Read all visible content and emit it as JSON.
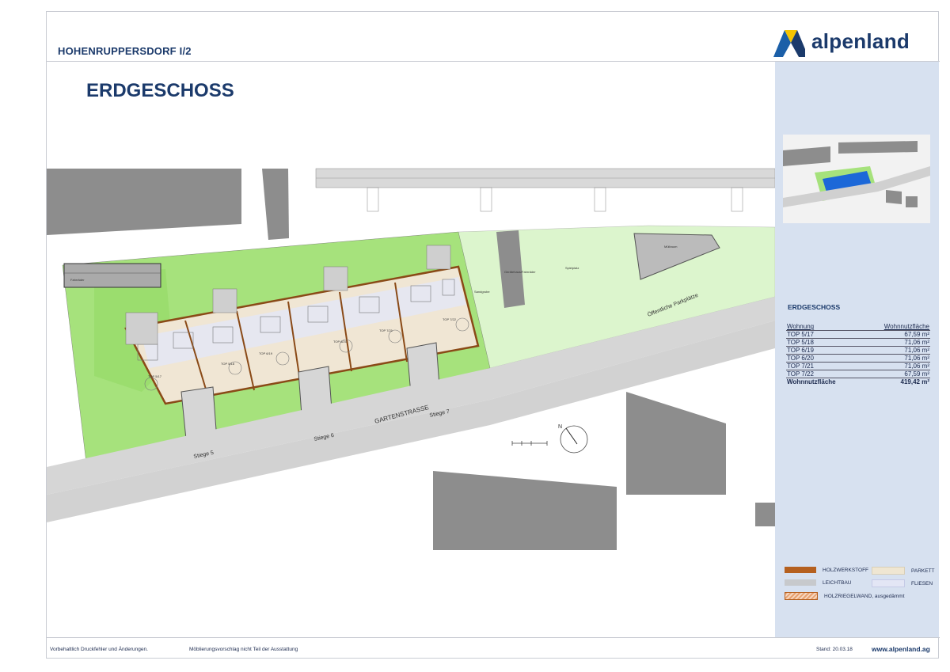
{
  "header": {
    "project": "HOHENRUPPERSDORF I/2",
    "logo_text": "alpenland"
  },
  "page_title": "ERDGESCHOSS",
  "plan": {
    "street": "GARTENSTRASSE",
    "stairs": [
      "Stiege 5",
      "Stiege 6",
      "Stiege 7"
    ],
    "parking": "Öffentliche Parkplätze",
    "labels": {
      "bike": "Fahrräder",
      "garage": "Gerätehaus/Fahrräder",
      "play": "Spielplatz",
      "sand": "Sandgrube",
      "waste": "Müllraum"
    },
    "units": [
      "TOP 5/17",
      "TOP 5/18",
      "TOP 6/19",
      "TOP 6/20",
      "TOP 7/21",
      "TOP 7/22"
    ]
  },
  "areas": {
    "title": "ERDGESCHOSS",
    "col_unit": "Wohnung",
    "col_area": "Wohnnutzfläche",
    "rows": [
      {
        "unit": "TOP 5/17",
        "area": "67,59 m²"
      },
      {
        "unit": "TOP 5/18",
        "area": "71,06 m²"
      },
      {
        "unit": "TOP 6/19",
        "area": "71,06 m²"
      },
      {
        "unit": "TOP 6/20",
        "area": "71,06 m²"
      },
      {
        "unit": "TOP 7/21",
        "area": "71,06 m²"
      },
      {
        "unit": "TOP 7/22",
        "area": "67,59 m²"
      }
    ],
    "total_label": "Wohnnutzfläche",
    "total_value": "419,42 m²"
  },
  "legend": {
    "holzwerkstoff": "HOLZWERKSTOFF",
    "parkett": "PARKETT",
    "leichtbau": "LEICHTBAU",
    "fliesen": "FLIESEN",
    "holzriegel": "HOLZRIEGELWAND, ausgedämmt",
    "colors": {
      "holzwerkstoff": "#b5601f",
      "parkett": "#efe6d2",
      "leichtbau": "#c7c9cc",
      "fliesen": "#e3e6f5",
      "holzriegel": "#e8a070"
    }
  },
  "footer": {
    "note1": "Vorbehaltlich Druckfehler und Änderungen.",
    "note2": "Möblierungsvorschlag nicht Teil der Ausstattung",
    "date": "Stand: 20.03.18",
    "website": "www.alpenland.ag"
  },
  "colors": {
    "brand_blue": "#1b3a6b",
    "brand_yellow": "#f5c400",
    "lawn": "#b9ea8c",
    "sidebar": "#d7e1f0"
  }
}
